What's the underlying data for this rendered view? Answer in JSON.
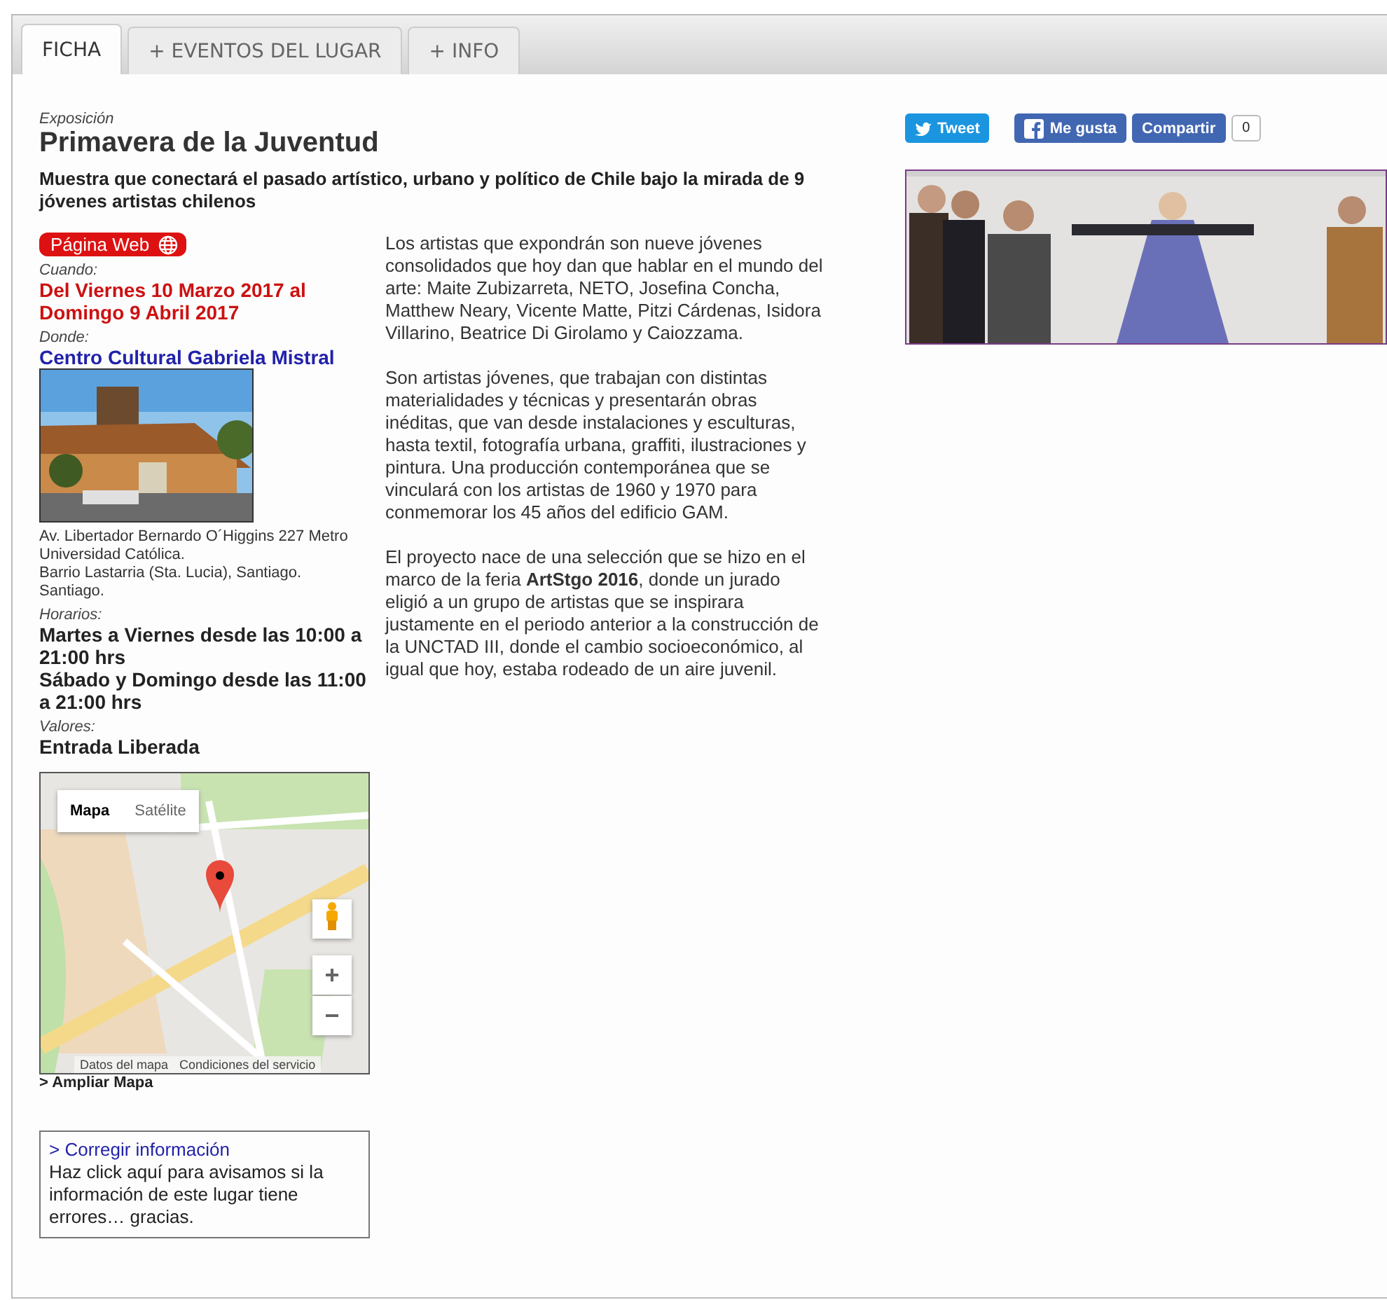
{
  "tabs": [
    {
      "label": "FICHA",
      "selected": true
    },
    {
      "label": "+ EVENTOS DEL LUGAR",
      "selected": false
    },
    {
      "label": "+ INFO",
      "selected": false
    }
  ],
  "event": {
    "category": "Exposición",
    "title": "Primavera de la Juventud",
    "subtitle": "Muestra que conectará el pasado artístico, urbano y político de Chile bajo la mirada de 9 jóvenes artistas chilenos"
  },
  "web_button": "Página Web",
  "details": [
    {
      "label": "Cuando:",
      "kind": "date",
      "lines": [
        "Del Viernes 10 Marzo 2017 al Domingo 9 Abril 2017"
      ]
    },
    {
      "label": "Donde:",
      "kind": "place",
      "lines": [
        "Centro Cultural Gabriela Mistral"
      ]
    }
  ],
  "address": [
    "Av. Libertador Bernardo O´Higgins 227 Metro Universidad Católica.",
    "Barrio Lastarria (Sta. Lucia), Santiago. Santiago."
  ],
  "schedule": {
    "label": "Horarios:",
    "lines": [
      "Martes a Viernes desde las 10:00 a 21:00 hrs",
      "Sábado y Domingo desde las 11:00 a 21:00 hrs"
    ]
  },
  "prices": {
    "label": "Valores:",
    "lines": [
      "Entrada Liberada"
    ]
  },
  "map": {
    "types": [
      {
        "label": "Mapa",
        "selected": true
      },
      {
        "label": "Satélite",
        "selected": false
      }
    ],
    "zoom_in": "+",
    "zoom_out": "−",
    "footer": [
      "Datos del mapa",
      "Condiciones del servicio"
    ],
    "enlarge": "> Ampliar Mapa"
  },
  "correction": {
    "link": "> Corregir información",
    "text": "Haz click aquí para avisamos si la información de este lugar tiene errores… gracias."
  },
  "description": [
    "Los artistas que expondrán son nueve jóvenes consolidados que hoy dan que hablar en el mundo del arte: Maite Zubizarreta, NETO, Josefina Concha, Matthew Neary, Vicente Matte, Pitzi Cárdenas, Isidora Villarino, Beatrice Di Girolamo y Caiozzama.",
    "Son artistas jóvenes, que trabajan con distintas materialidades y técnicas y presentarán obras inéditas, que van desde instalaciones y esculturas, hasta textil, fotografía urbana, graffiti, ilustraciones y pintura. Una producción contemporánea que se vinculará con los artistas de 1960 y 1970 para conmemorar los 45 años del edificio GAM.",
    "El proyecto nace de una selección que se hizo en el marco de la feria **ArtStgo 2016**, donde un jurado eligió a un grupo de artistas que se inspirara justamente en el periodo anterior a la construcción de la UNCTAD III, donde el cambio socioeconómico, al igual que hoy, estaba rodeado de un aire juvenil."
  ],
  "social": {
    "tweet": "Tweet",
    "like": "Me gusta",
    "share": "Compartir",
    "count": "0"
  }
}
